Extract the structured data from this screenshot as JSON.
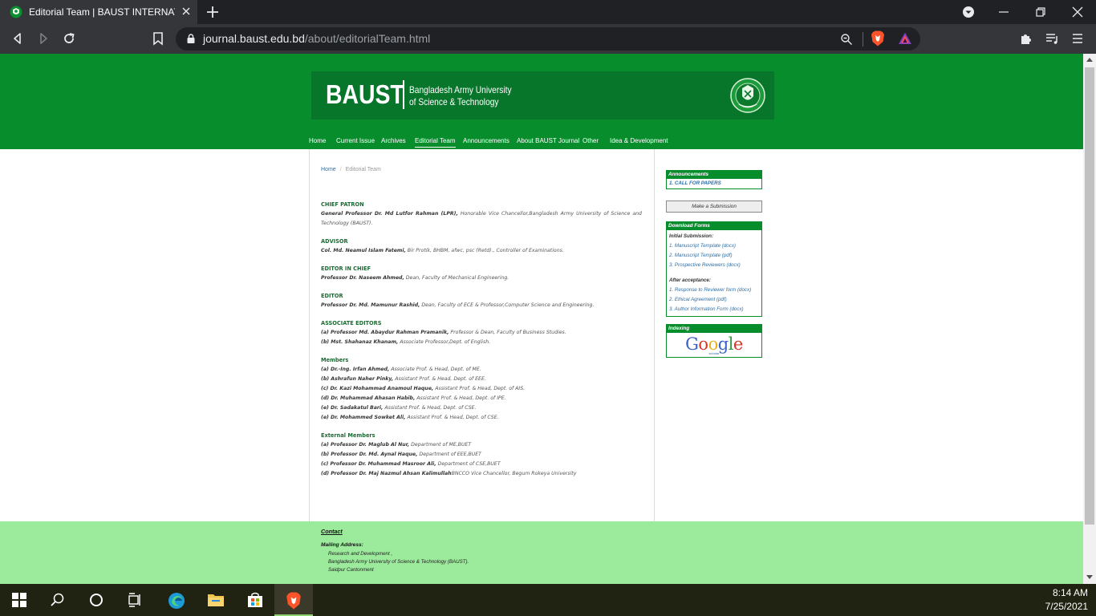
{
  "browser": {
    "tab_title": "Editorial Team | BAUST INTERNAT",
    "url_host": "journal.baust.edu.bd",
    "url_path": "/about/editorialTeam.html"
  },
  "header": {
    "brand": "BAUST",
    "uni_line1": "Bangladesh Army University",
    "uni_line2": "of Science & Technology"
  },
  "nav": {
    "items": [
      {
        "label": "Home"
      },
      {
        "label": "Current Issue"
      },
      {
        "label": "Archives"
      },
      {
        "label": "Editorial Team",
        "active": true
      },
      {
        "label": "Announcements"
      },
      {
        "label": "About BAUST Journal"
      },
      {
        "label": "Other"
      },
      {
        "label": "Idea & Development"
      }
    ]
  },
  "breadcrumb": {
    "home": "Home",
    "sep": "/",
    "current": "Editorial Team"
  },
  "sections": {
    "chief_patron": {
      "title": "CHIEF PATRON",
      "name": "General Professor Dr. Md Lutfor Rahman (LPR),",
      "desc": " Honorable Vice Chancellor,Bangladesh Army University of Science and Technology (BAUST)."
    },
    "advisor": {
      "title": "ADVISOR",
      "name": "Col. Md. Neamul Islam Fatemi,",
      "desc": " Bir Protik, BHBM, afwc, psc (Retd)., Controller of Examinations."
    },
    "editor_in_chief": {
      "title": "EDITOR IN CHIEF",
      "name": "Professor Dr. Naseem Ahmed,",
      "desc": " Dean, Faculty of Mechanical Engineering."
    },
    "editor": {
      "title": "EDITOR",
      "name": "Professor Dr. Md. Mamunur Rashid,",
      "desc": " Dean, Faculty of ECE & Professor,Computer Science and Engineering."
    },
    "associate_editors": {
      "title": "ASSOCIATE EDITORS",
      "people": [
        {
          "name": "(a) Professor Md. Abaydur Rahman Pramanik,",
          "desc": " Professor & Dean, Faculty of Business Studies."
        },
        {
          "name": "(b) Mst. Shahanaz Khanam,",
          "desc": " Associate Professor,Dept. of English."
        }
      ]
    },
    "members": {
      "title": "Members",
      "people": [
        {
          "name": "(a) Dr.-Ing. Irfan Ahmed,",
          "desc": " Associate Prof. & Head, Dept. of ME."
        },
        {
          "name": "(b) Ashrafun Naher Pinky,",
          "desc": " Assistant Prof. & Head, Dept. of EEE."
        },
        {
          "name": "(c) Dr. Kazi Mohammad Anamoul Haque,",
          "desc": " Assistant Prof. & Head, Dept. of AIS."
        },
        {
          "name": "(d) Dr. Muhammad Ahasan Habib,",
          "desc": " Assistant Prof. & Head, Dept. of IPE."
        },
        {
          "name": "(e) Dr. Sadakatul Bari,",
          "desc": " Assistant Prof. & Head, Dept. of CSE."
        },
        {
          "name": "(e) Dr. Mohammed Sowket Ali,",
          "desc": " Assistant Prof. & Head, Dept. of CSE."
        }
      ]
    },
    "external_members": {
      "title": "External Members",
      "people": [
        {
          "name": "(a) Professor Dr. Maglub Al Nur,",
          "desc": " Department of ME,BUET"
        },
        {
          "name": "(b) Professor Dr. Md. Aynal Haque,",
          "desc": " Department of EEE,BUET"
        },
        {
          "name": "(c) Professor Dr. Muhammad Masroor Ali,",
          "desc": " Department of CSE,BUET"
        },
        {
          "name": "(d) Professor Dr. Maj Nazmul Ahsan Kalimullah",
          "desc": "BNCCO Vice Chancellor, Begum Rokeya University"
        }
      ]
    }
  },
  "sidebar": {
    "announcements": {
      "title": "Announcements",
      "items": [
        "1. CALL FOR PAPERS"
      ]
    },
    "submit_label": "Make a Submission",
    "download": {
      "title": "Download Forms",
      "initial_label": "Initial Submission:",
      "initial": [
        "1. Manuscript Template (docx)",
        "2. Manuscript Template (pdf)",
        "3. Prospective Reviewers (docx)"
      ],
      "after_label": "After acceptance:",
      "after": [
        "1. Response to Reviewer form (docx)",
        "2. Ethical Agreement (pdf)",
        "3. Author Information Form (docx)"
      ]
    },
    "indexing": {
      "title": "Indexing",
      "logo_text": "Google",
      "logo_sub": "scholar"
    }
  },
  "footer": {
    "contact": "Contact",
    "mailing": "Mailing Address:",
    "lines": [
      "Research and Development ,",
      "Bangladesh Army University of Science & Technology (BAUST).",
      "Saidpur Cantonment"
    ]
  },
  "taskbar": {
    "time": "8:14 AM",
    "date": "7/25/2021"
  },
  "colors": {
    "header_green": "#088d2d",
    "footer_green": "#9cea9c",
    "section_title": "#1a6b32",
    "link_blue": "#2d6fa8"
  }
}
